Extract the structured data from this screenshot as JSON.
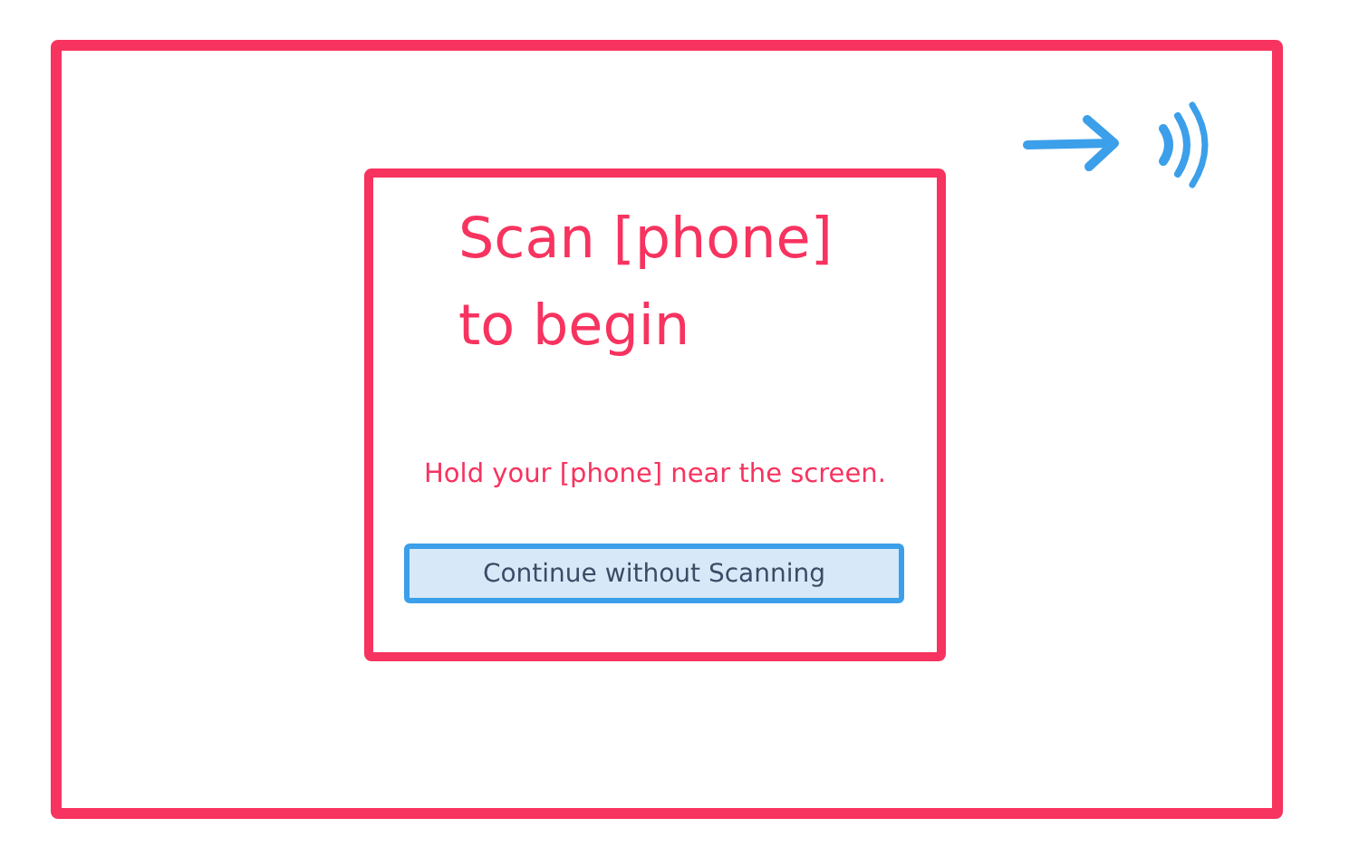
{
  "card": {
    "title": "Scan [phone] to begin",
    "message": "Hold your [phone] near the screen.",
    "button": "Continue without Scanning"
  }
}
